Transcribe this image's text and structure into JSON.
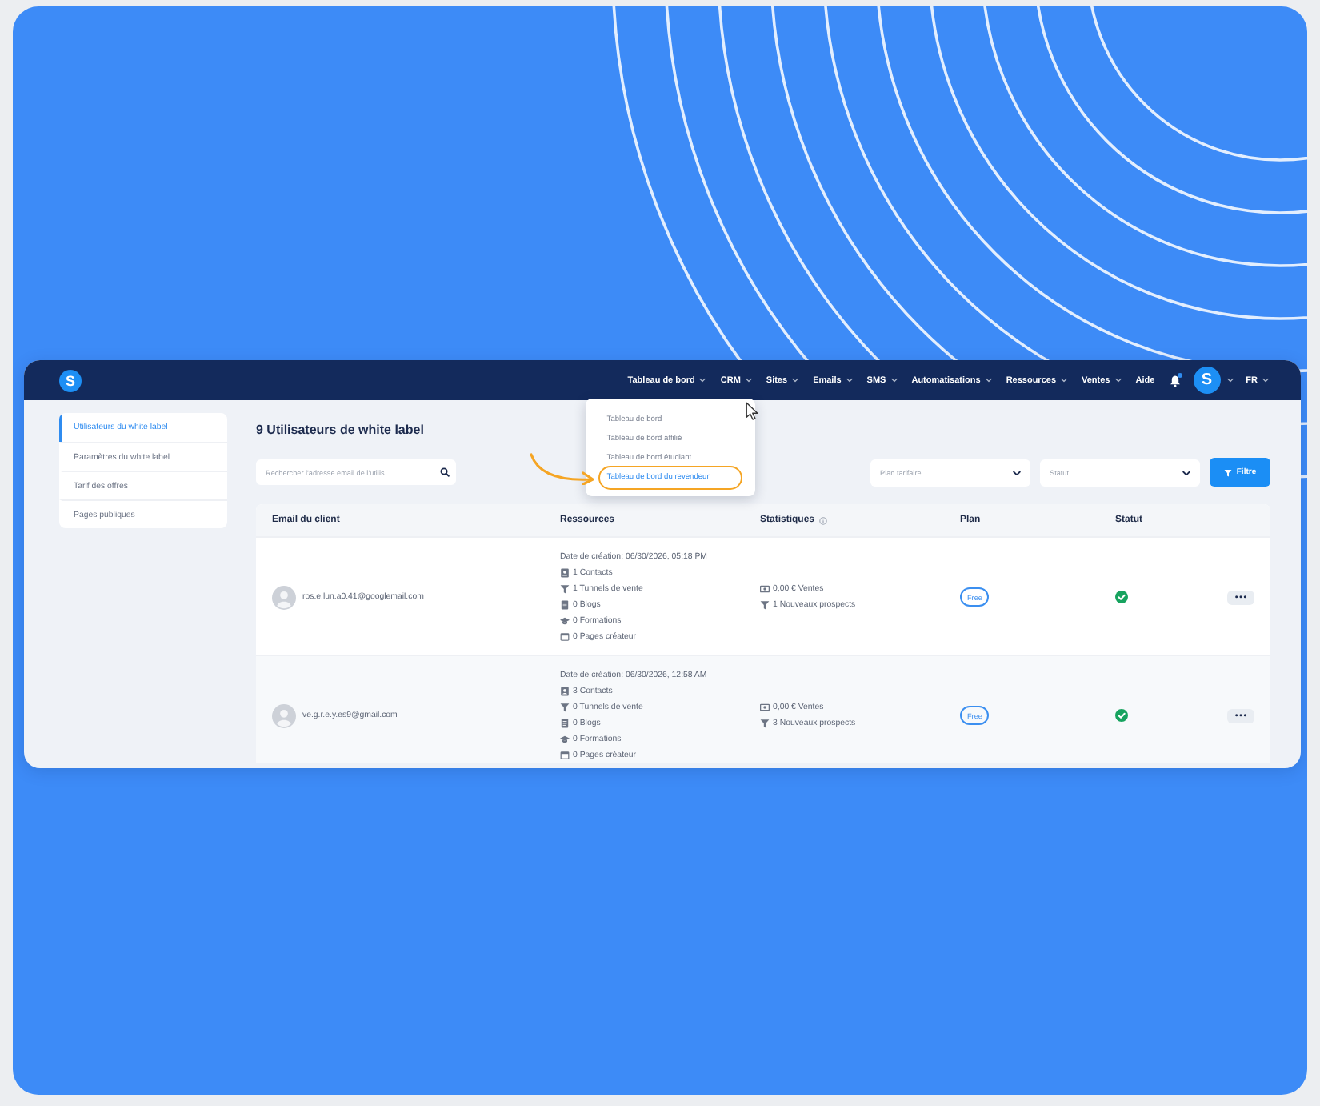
{
  "logo": "S",
  "nav": {
    "items": [
      {
        "label": "Tableau de bord",
        "kind": "menu",
        "menu": [
          {
            "label": "Tableau de bord",
            "selected": false
          },
          {
            "label": "Tableau de bord affilié",
            "selected": false
          },
          {
            "label": "Tableau de bord étudiant",
            "selected": false
          },
          {
            "label": "Tableau de bord du revendeur",
            "selected": true
          }
        ]
      },
      {
        "label": "CRM",
        "kind": "menu"
      },
      {
        "label": "Sites",
        "kind": "menu"
      },
      {
        "label": "Emails",
        "kind": "menu"
      },
      {
        "label": "SMS",
        "kind": "menu"
      },
      {
        "label": "Automatisations",
        "kind": "menu"
      },
      {
        "label": "Ressources",
        "kind": "menu"
      },
      {
        "label": "Ventes",
        "kind": "menu"
      },
      {
        "label": "Aide",
        "kind": "link"
      }
    ],
    "notifications": {
      "unread": true
    },
    "avatar": "S",
    "language": "FR"
  },
  "sidebar": {
    "items": [
      {
        "label": "Utilisateurs du white label",
        "selected": true
      },
      {
        "label": "Paramètres du white label",
        "selected": false
      },
      {
        "label": "Tarif des offres",
        "selected": false
      },
      {
        "label": "Pages publiques",
        "selected": false
      }
    ]
  },
  "title": "9 Utilisateurs de white label",
  "search": {
    "placeholder": "Rechercher l'adresse email de l'utilis..."
  },
  "filters": {
    "selects": [
      {
        "placeholder": "Plan tarifaire"
      },
      {
        "placeholder": "Statut"
      }
    ],
    "button": "Filtre"
  },
  "table": {
    "columns": [
      {
        "label": "Email du client",
        "kind": "text"
      },
      {
        "label": "Ressources",
        "kind": "text"
      },
      {
        "label": "Statistiques",
        "kind": "info"
      },
      {
        "label": "Plan",
        "kind": "text"
      },
      {
        "label": "Statut",
        "kind": "text"
      }
    ],
    "rows": [
      {
        "email": "ros.e.lun.a0.41@googlemail.com",
        "created": "Date de création: 06/30/2026, 05:18 PM",
        "resources": [
          {
            "kind": "contacts",
            "text": "1 Contacts"
          },
          {
            "kind": "funnels",
            "text": "1 Tunnels de vente"
          },
          {
            "kind": "blogs",
            "text": "0 Blogs"
          },
          {
            "kind": "courses",
            "text": "0 Formations"
          },
          {
            "kind": "pages",
            "text": "0 Pages créateur"
          }
        ],
        "stats": [
          {
            "kind": "sales",
            "text": "0,00 € Ventes"
          },
          {
            "kind": "leads",
            "text": "1 Nouveaux prospects"
          }
        ],
        "plan": "Free",
        "active": true
      },
      {
        "email": "ve.g.r.e.y.es9@gmail.com",
        "created": "Date de création: 06/30/2026, 12:58 AM",
        "resources": [
          {
            "kind": "contacts",
            "text": "3 Contacts"
          },
          {
            "kind": "funnels",
            "text": "0 Tunnels de vente"
          },
          {
            "kind": "blogs",
            "text": "0 Blogs"
          },
          {
            "kind": "courses",
            "text": "0 Formations"
          },
          {
            "kind": "pages",
            "text": "0 Pages créateur"
          }
        ],
        "stats": [
          {
            "kind": "sales",
            "text": "0,00 € Ventes"
          },
          {
            "kind": "leads",
            "text": "3 Nouveaux prospects"
          }
        ],
        "plan": "Free",
        "active": true
      }
    ]
  }
}
